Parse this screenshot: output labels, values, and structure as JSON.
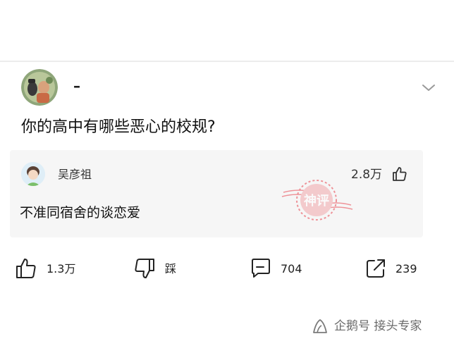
{
  "post": {
    "author_name": "–",
    "question": "你的高中有哪些恶心的校规?"
  },
  "comment": {
    "author": "吴彦祖",
    "likes": "2.8万",
    "text": "不准同宿舍的谈恋爱",
    "stamp_text": "神评"
  },
  "actions": {
    "like_count": "1.3万",
    "dislike_label": "踩",
    "comment_count": "704",
    "share_count": "239"
  },
  "watermark": {
    "text": "企鹅号 接头专家"
  },
  "colors": {
    "card_bg": "#f6f6f6",
    "stamp_red": "#e8404a"
  }
}
